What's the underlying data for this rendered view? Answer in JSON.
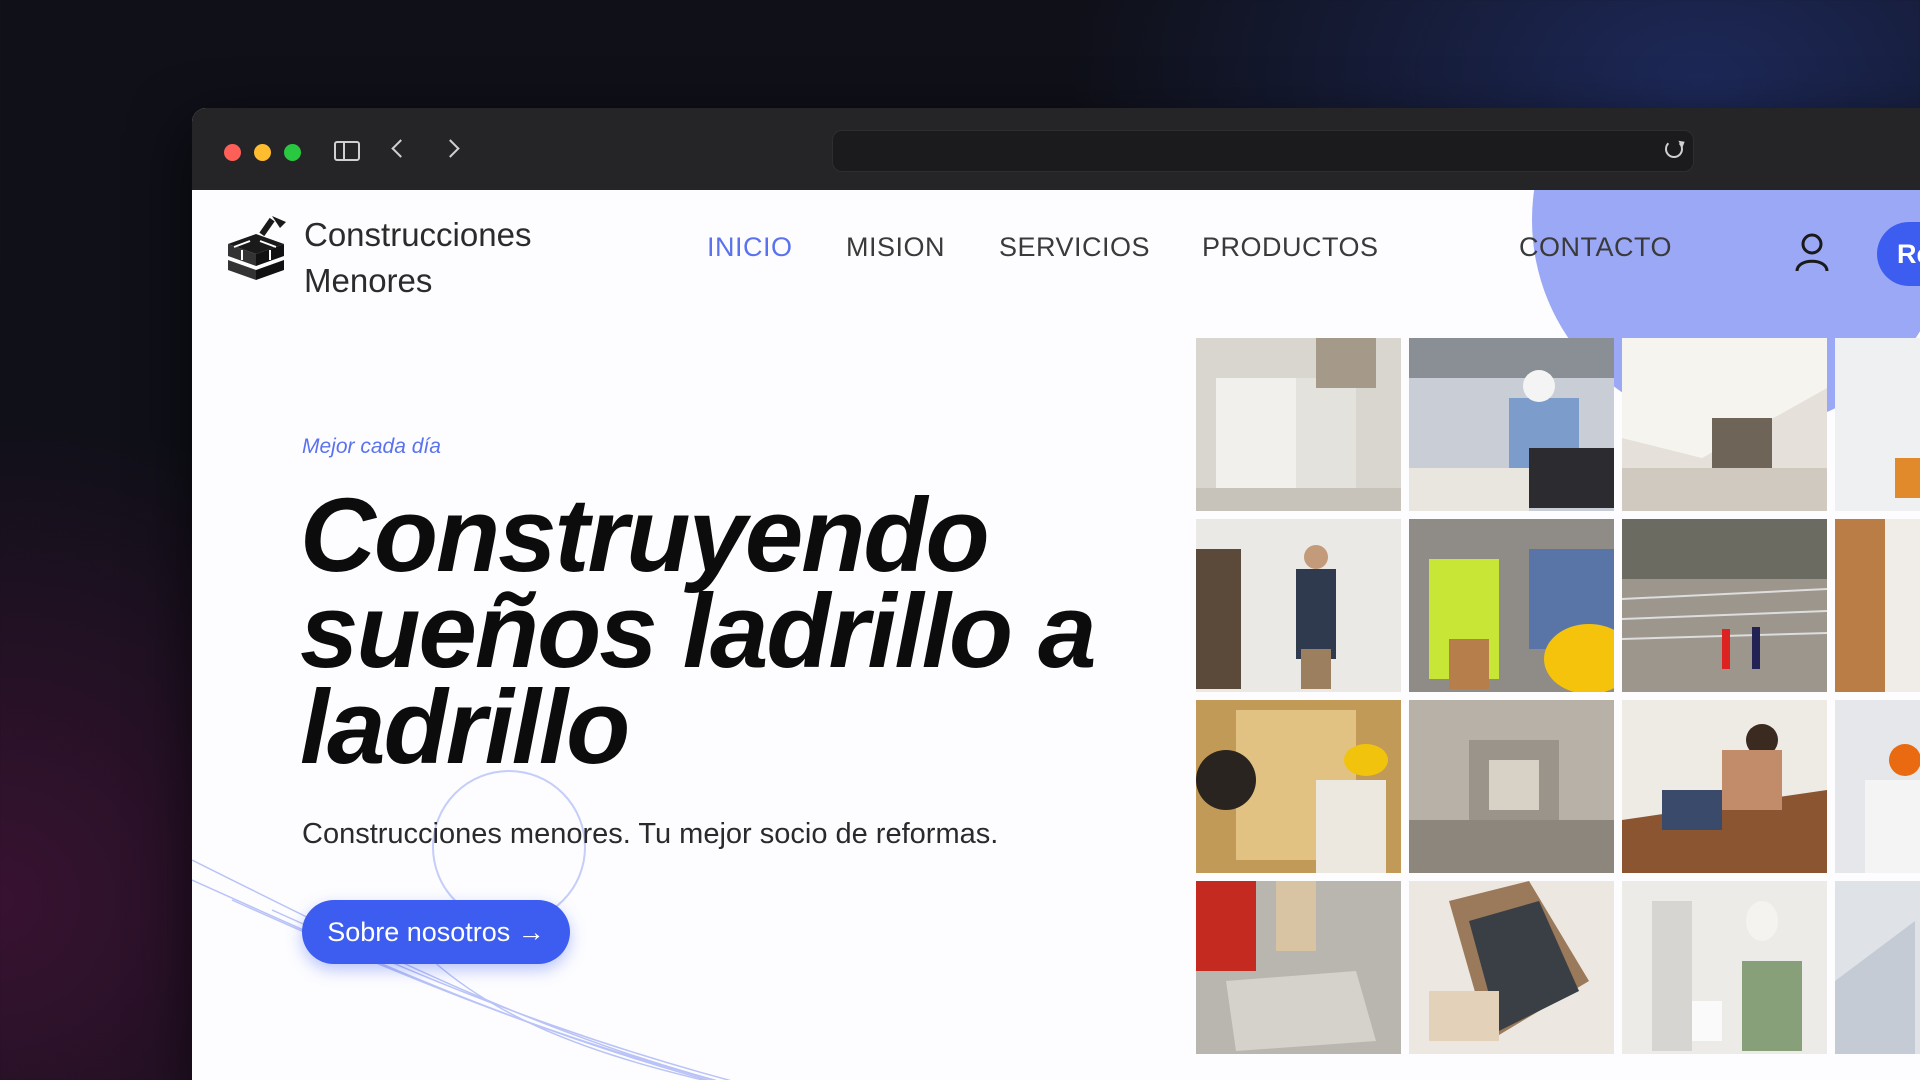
{
  "browser": {
    "url": "",
    "buttons": {
      "sidebar": "sidebar-toggle",
      "back": "back",
      "forward": "forward",
      "reload": "reload"
    }
  },
  "brand": {
    "line1": "Construcciones",
    "line2": "Menores"
  },
  "nav": {
    "items": [
      "INICIO",
      "MISION",
      "SERVICIOS",
      "PRODUCTOS",
      "CONTACTO"
    ],
    "active": "INICIO",
    "register_label": "Re"
  },
  "hero": {
    "tagline": "Mejor cada día",
    "headline_line1": "Construyendo",
    "headline_line2": "sueños ladrillo a",
    "headline_line3": "ladrillo",
    "subtitle": "Construcciones menores. Tu mejor socio de reformas.",
    "cta_label": "Sobre nosotros →"
  },
  "colors": {
    "accent": "#3d5cf0",
    "nav_active": "#5b72ee",
    "blob": "#9aa8f5"
  },
  "gallery": {
    "tiles": [
      "workers-lifting-block",
      "engineer-laptop-site",
      "attic-renovation",
      "kitchen-worker",
      "worker-on-scaffold",
      "handshake-hardhat",
      "aerial-construction-site",
      "wood-wall",
      "drywall-installation",
      "gutted-room",
      "woman-laying-floor",
      "architect-plans",
      "tile-laying",
      "wood-samples",
      "modern-bathroom",
      "stairs"
    ]
  }
}
